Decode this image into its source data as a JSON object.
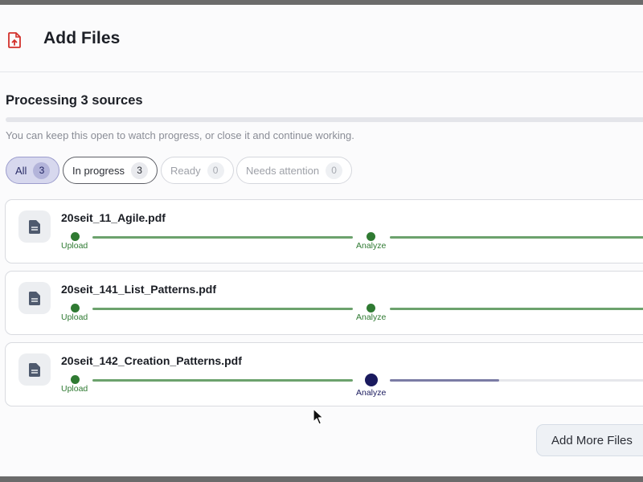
{
  "header": {
    "title": "Add Files",
    "icon": "file-upload-icon"
  },
  "processing": {
    "title": "Processing 3 sources",
    "hint": "You can keep this open to watch progress, or close it and continue working."
  },
  "filters": [
    {
      "label": "All",
      "count": "3",
      "state": "active"
    },
    {
      "label": "In progress",
      "count": "3",
      "state": "enabled"
    },
    {
      "label": "Ready",
      "count": "0",
      "state": "disabled"
    },
    {
      "label": "Needs attention",
      "count": "0",
      "state": "disabled"
    }
  ],
  "files": [
    {
      "name": "20seit_11_Agile.pdf",
      "stages": [
        {
          "label": "Upload",
          "status": "done"
        },
        {
          "label": "Analyze",
          "status": "done"
        }
      ]
    },
    {
      "name": "20seit_141_List_Patterns.pdf",
      "stages": [
        {
          "label": "Upload",
          "status": "done"
        },
        {
          "label": "Analyze",
          "status": "done"
        }
      ]
    },
    {
      "name": "20seit_142_Creation_Patterns.pdf",
      "stages": [
        {
          "label": "Upload",
          "status": "done"
        },
        {
          "label": "Analyze",
          "status": "current"
        }
      ],
      "analyze_progress": 0.4
    }
  ],
  "add_more_label": "Add More Files",
  "colors": {
    "done": "#2f7a32",
    "current": "#1a1a5e",
    "accent": "#d7d8ee"
  }
}
